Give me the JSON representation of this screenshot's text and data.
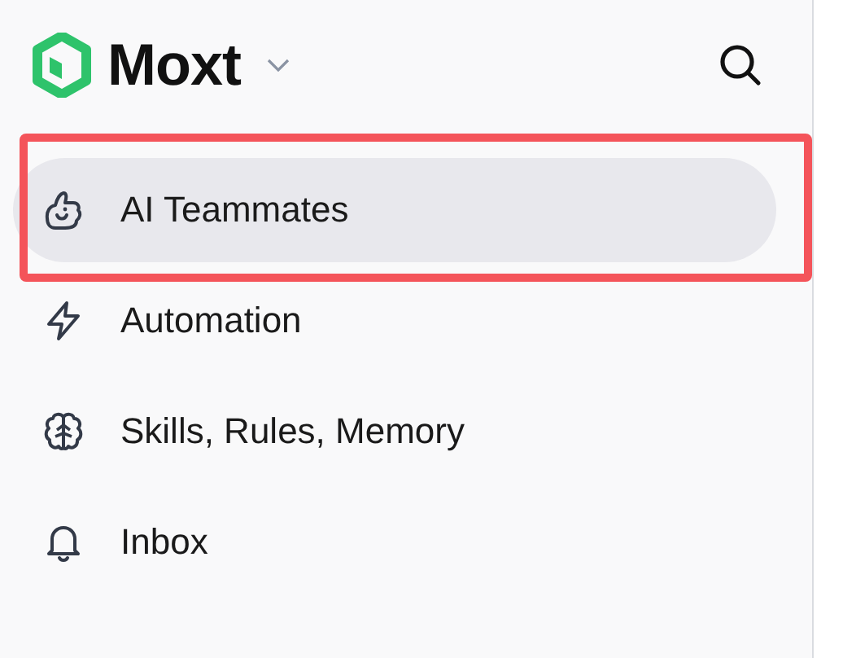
{
  "workspace": {
    "name": "Moxt"
  },
  "nav": [
    {
      "kind": "teammates",
      "label": "AI Teammates",
      "selected": true,
      "highlighted": true
    },
    {
      "kind": "automation",
      "label": "Automation",
      "selected": false,
      "highlighted": false
    },
    {
      "kind": "skills",
      "label": "Skills, Rules, Memory",
      "selected": false,
      "highlighted": false
    },
    {
      "kind": "inbox",
      "label": "Inbox",
      "selected": false,
      "highlighted": false
    }
  ]
}
